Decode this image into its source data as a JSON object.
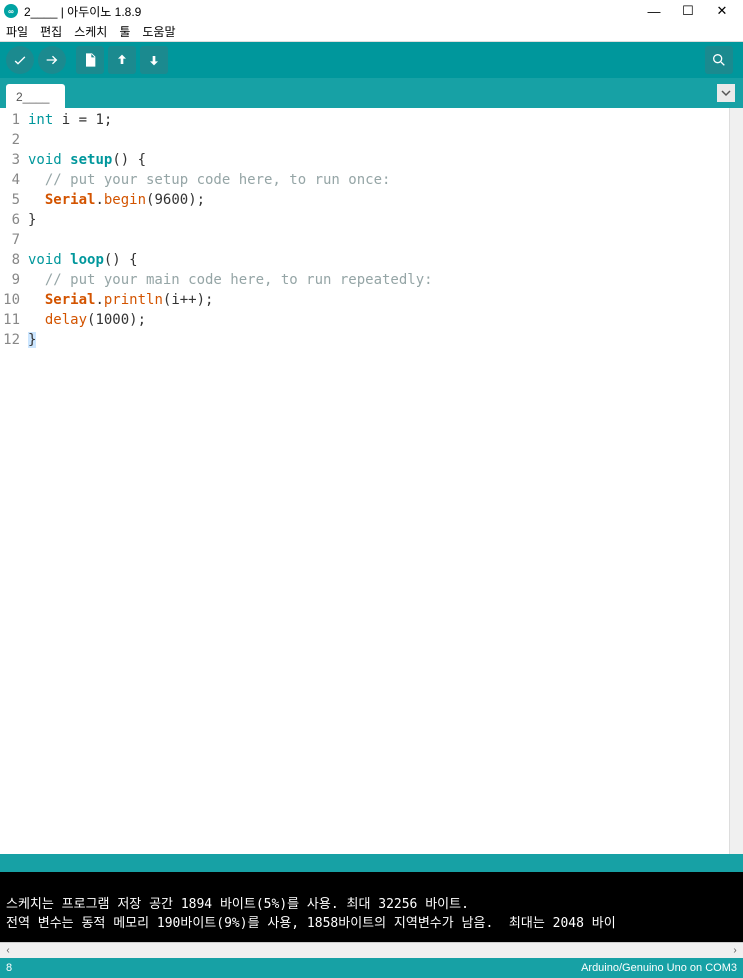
{
  "window": {
    "title": "2____ | 아두이노 1.8.9"
  },
  "menu": {
    "file": "파일",
    "edit": "편집",
    "sketch": "스케치",
    "tools": "툴",
    "help": "도움말"
  },
  "tabs": {
    "active": "2____"
  },
  "code": {
    "lines": [
      {
        "n": "1",
        "tokens": [
          {
            "t": "int",
            "c": "kw-type"
          },
          {
            "t": " i = "
          },
          {
            "t": "1",
            "c": "num"
          },
          {
            "t": ";"
          }
        ]
      },
      {
        "n": "2",
        "tokens": []
      },
      {
        "n": "3",
        "tokens": [
          {
            "t": "void",
            "c": "kw-type"
          },
          {
            "t": " "
          },
          {
            "t": "setup",
            "c": "kw-func"
          },
          {
            "t": "() {"
          }
        ]
      },
      {
        "n": "4",
        "tokens": [
          {
            "t": "  "
          },
          {
            "t": "// put your setup code here, to run once:",
            "c": "comment"
          }
        ]
      },
      {
        "n": "5",
        "tokens": [
          {
            "t": "  "
          },
          {
            "t": "Serial",
            "c": "kw-class"
          },
          {
            "t": "."
          },
          {
            "t": "begin",
            "c": "kw-method"
          },
          {
            "t": "("
          },
          {
            "t": "9600",
            "c": "num"
          },
          {
            "t": ");"
          }
        ]
      },
      {
        "n": "6",
        "tokens": [
          {
            "t": "}"
          }
        ]
      },
      {
        "n": "7",
        "tokens": []
      },
      {
        "n": "8",
        "tokens": [
          {
            "t": "void",
            "c": "kw-type"
          },
          {
            "t": " "
          },
          {
            "t": "loop",
            "c": "kw-func"
          },
          {
            "t": "() {"
          }
        ]
      },
      {
        "n": "9",
        "tokens": [
          {
            "t": "  "
          },
          {
            "t": "// put your main code here, to run repeatedly:",
            "c": "comment"
          }
        ]
      },
      {
        "n": "10",
        "tokens": [
          {
            "t": "  "
          },
          {
            "t": "Serial",
            "c": "kw-class"
          },
          {
            "t": "."
          },
          {
            "t": "println",
            "c": "kw-method"
          },
          {
            "t": "(i++);"
          }
        ]
      },
      {
        "n": "11",
        "tokens": [
          {
            "t": "  "
          },
          {
            "t": "delay",
            "c": "kw-method"
          },
          {
            "t": "("
          },
          {
            "t": "1000",
            "c": "num"
          },
          {
            "t": ");"
          }
        ]
      },
      {
        "n": "12",
        "tokens": [
          {
            "t": "}",
            "c": "hl-brace"
          }
        ]
      }
    ]
  },
  "console": {
    "line1": "스케치는 프로그램 저장 공간 1894 바이트(5%)를 사용. 최대 32256 바이트.",
    "line2": "전역 변수는 동적 메모리 190바이트(9%)를 사용, 1858바이트의 지역변수가 남음.  최대는 2048 바이"
  },
  "status": {
    "left": "8",
    "right": "Arduino/Genuino Uno on COM3"
  }
}
